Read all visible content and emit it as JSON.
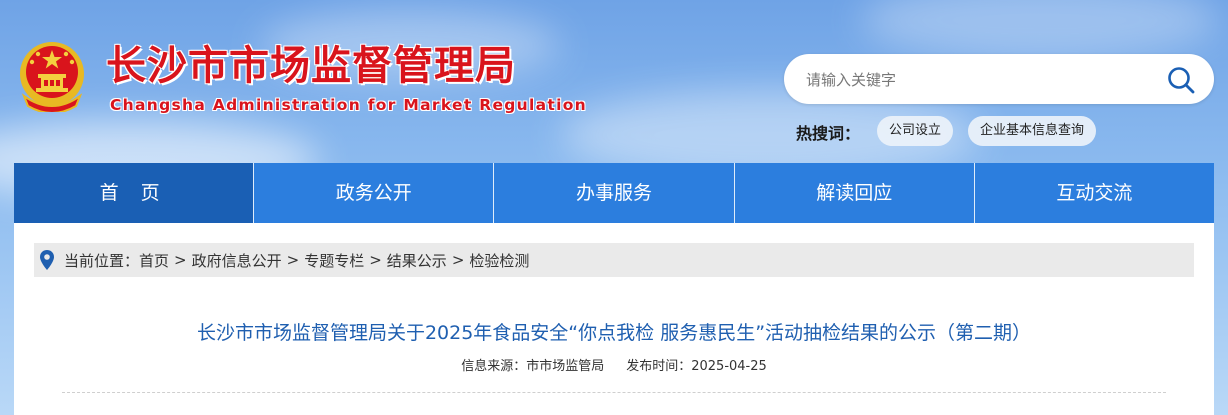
{
  "header": {
    "title": "长沙市市场监督管理局",
    "subtitle": "Changsha Administration for Market Regulation",
    "brand_color": "#d9141c"
  },
  "search": {
    "placeholder": "请输入关键字",
    "value": "",
    "icon": "search-icon",
    "hot_label": "热搜词：",
    "hot_terms": [
      "公司设立",
      "企业基本信息查询"
    ]
  },
  "nav": {
    "items": [
      "首 页",
      "政务公开",
      "办事服务",
      "解读回应",
      "互动交流"
    ],
    "active_index": 0,
    "color": "#2c7ede",
    "active_color": "#1a5fb4"
  },
  "breadcrumb": {
    "icon": "location-pin-icon",
    "prefix": "当前位置：",
    "items": [
      "首页",
      "政府信息公开",
      "专题专栏",
      "结果公示",
      "检验检测"
    ],
    "separator": ">"
  },
  "article": {
    "title": "长沙市市场监督管理局关于2025年食品安全“你点我检 服务惠民生”活动抽检结果的公示（第二期）",
    "source_label": "信息来源：",
    "source": "市市场监管局",
    "date_label": "发布时间：",
    "date": "2025-04-25",
    "title_color": "#1f5fb0"
  }
}
